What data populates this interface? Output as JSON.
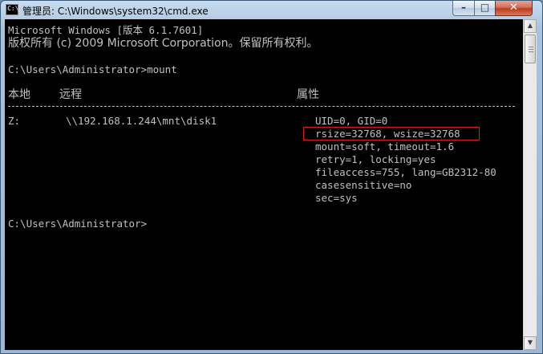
{
  "window": {
    "title": "管理员: C:\\Windows\\system32\\cmd.exe",
    "icon": "C:\\",
    "controls": {
      "minimize": "–",
      "maximize": "□",
      "close": "✕"
    }
  },
  "console": {
    "banner1": "Microsoft Windows [版本 6.1.7601]",
    "banner2": "版权所有 (c) 2009 Microsoft Corporation。保留所有权利。",
    "prompt1": "C:\\Users\\Administrator>mount",
    "header": {
      "local": "本地",
      "remote": "远程",
      "props": "属性"
    },
    "row": {
      "local": "Z:",
      "remote": "\\\\192.168.1.244\\mnt\\disk1",
      "prop1": "UID=0, GID=0",
      "prop2": "rsize=32768, wsize=32768",
      "prop3": "mount=soft, timeout=1.6",
      "prop4": "retry=1, locking=yes",
      "prop5": "fileaccess=755, lang=GB2312-80",
      "prop6": "casesensitive=no",
      "prop7": "sec=sys"
    },
    "prompt2": "C:\\Users\\Administrator>"
  },
  "scrollbar": {
    "up_arrow": "▲",
    "down_arrow": "▼"
  },
  "colors": {
    "console_bg": "#000000",
    "console_text": "#c0c0c0",
    "highlight": "#e0141a"
  }
}
